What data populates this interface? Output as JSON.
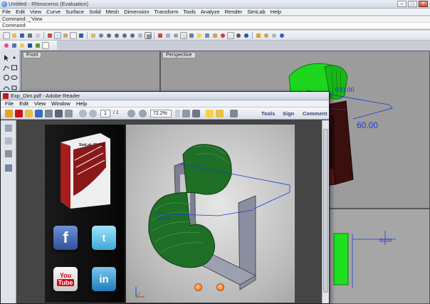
{
  "rhino": {
    "title": "Untitled - Rhinoceros (Evaluation)",
    "menu": [
      "File",
      "Edit",
      "View",
      "Curve",
      "Surface",
      "Solid",
      "Mesh",
      "Dimension",
      "Transform",
      "Tools",
      "Analyze",
      "Render",
      "SimLab",
      "Help"
    ],
    "command_history": "Command: _'View",
    "command_prompt": "Command:",
    "viewports": {
      "front": "Front",
      "perspective": "Perspective"
    },
    "dimension_text_1": "600.00",
    "dimension_text_2": "60.00",
    "dimension_text_3": "60.00"
  },
  "reader": {
    "title": "Exp_Dim.pdf - Adobe Reader",
    "menu": [
      "File",
      "Edit",
      "View",
      "Window",
      "Help"
    ],
    "page_current": "1",
    "page_total": "/ 1",
    "zoom": "72.2%",
    "links": {
      "tools": "Tools",
      "sign": "Sign",
      "comment": "Comment"
    },
    "product_box_text": "SimLab 3D PDF",
    "product_box_subtext": "3.5 for Rhino",
    "dimension_text": "600.00"
  },
  "colors": {
    "viewport_bg": "#9c9c9c",
    "chair_green": "#1fd61f",
    "chair_dark_green": "#1d7a2a",
    "frame_brown": "#4a1414",
    "dim_blue": "#1f3bd6"
  },
  "social": [
    "facebook",
    "twitter",
    "youtube",
    "linkedin"
  ]
}
